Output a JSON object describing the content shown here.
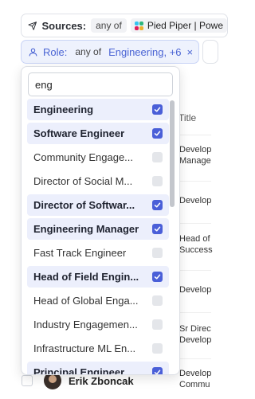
{
  "filters": {
    "sources": {
      "label": "Sources:",
      "operator": "any of",
      "value": "Pied Piper | Powe"
    },
    "role": {
      "label": "Role:",
      "operator": "any of",
      "value": "Engineering, +6",
      "clear": "×"
    }
  },
  "table": {
    "column_header": "Title",
    "cells": [
      {
        "line1": "Develop",
        "line2": "Manage"
      },
      {
        "line1": "Develop",
        "line2": ""
      },
      {
        "line1": "Head of",
        "line2": "Success"
      },
      {
        "line1": "Develop",
        "line2": ""
      },
      {
        "line1": "Sr Direc",
        "line2": "Develop"
      },
      {
        "line1": "Develop",
        "line2": "Commu"
      }
    ],
    "partial_row_name": "Erik Zboncak"
  },
  "dropdown": {
    "search_value": "eng",
    "options": [
      {
        "label": "Engineering",
        "selected": true
      },
      {
        "label": "Software Engineer",
        "selected": true
      },
      {
        "label": "Community Engage...",
        "selected": false
      },
      {
        "label": "Director of Social M...",
        "selected": false
      },
      {
        "label": "Director of Softwar...",
        "selected": true
      },
      {
        "label": "Engineering Manager",
        "selected": true
      },
      {
        "label": "Fast Track Engineer",
        "selected": false
      },
      {
        "label": "Head of Field Engin...",
        "selected": true
      },
      {
        "label": "Head of Global Enga...",
        "selected": false
      },
      {
        "label": "Industry Engagemen...",
        "selected": false
      },
      {
        "label": "Infrastructure ML En...",
        "selected": false
      },
      {
        "label": "Principal Engineer",
        "selected": true
      }
    ]
  },
  "colors": {
    "accent": "#4a5fd8",
    "selected_bg": "#eceffc",
    "chip_bg": "#eef2fd"
  }
}
